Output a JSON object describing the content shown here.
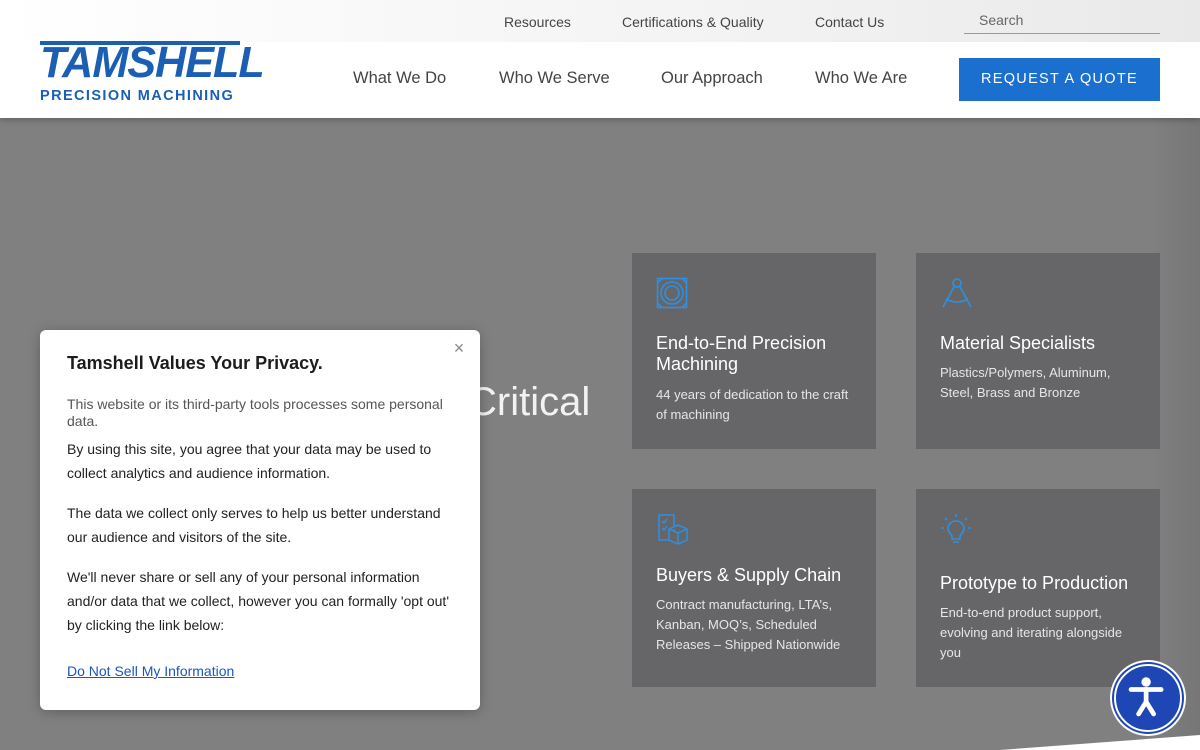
{
  "header": {
    "logo": {
      "wordmark": "TAMSHELL",
      "subtitle": "PRECISION MACHINING"
    },
    "util_nav": [
      "Resources",
      "Certifications & Quality",
      "Contact Us"
    ],
    "search": {
      "placeholder": "Search",
      "value": ""
    },
    "main_nav": [
      "What We Do",
      "Who We Serve",
      "Our Approach",
      "Who We Are"
    ],
    "cta_label": "REQUEST A QUOTE"
  },
  "hero": {
    "partial_text": "Critical"
  },
  "cards": [
    {
      "icon": "precision-part-icon",
      "title": "End-to-End Precision Machining",
      "desc": "44 years of dedication to the craft of machining"
    },
    {
      "icon": "compass-drafting-icon",
      "title": "Material Specialists",
      "desc": "Plastics/Polymers, Aluminum, Steel, Brass and Bronze"
    },
    {
      "icon": "boxes-checklist-icon",
      "title": "Buyers & Supply Chain",
      "desc": "Contract manufacturing, LTA’s, Kanban, MOQ’s, Scheduled Releases – Shipped Nationwide"
    },
    {
      "icon": "lightbulb-icon",
      "title": "Prototype to Production",
      "desc": "End-to-end product support, evolving and iterating alongside you"
    }
  ],
  "privacy": {
    "title": "Tamshell Values Your Privacy.",
    "intro": "This website or its third-party tools processes some personal data.",
    "paragraphs": [
      "By using this site, you agree that your data may be used to collect analytics and audience information.",
      "The data we collect only serves to help us better understand our audience and visitors of the site.",
      "We'll never share or sell any of your personal information and/or data that we collect, however you can formally 'opt out' by clicking the link below:"
    ],
    "link_label": "Do Not Sell My Information",
    "close_icon": "close-icon"
  },
  "colors": {
    "brand_blue": "#1a5fb4",
    "cta_blue": "#1a6fcf",
    "card_bg": "#666668",
    "icon_blue": "#2f8fe0",
    "a11y_blue": "#1f46b5"
  }
}
